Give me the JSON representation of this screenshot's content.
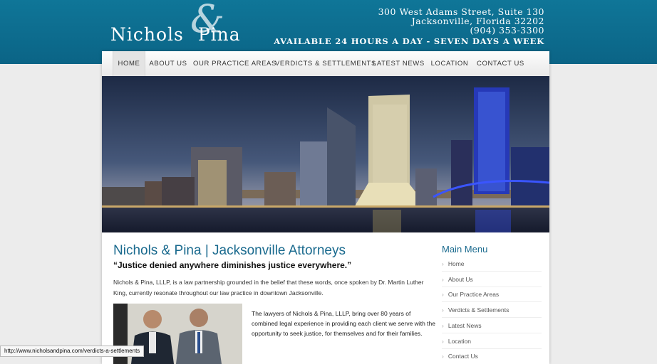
{
  "brand": {
    "name_left": "Nichols",
    "ampersand": "&",
    "name_right": "Pina"
  },
  "contact": {
    "street": "300 West Adams Street, Suite 130",
    "city": "Jacksonville, Florida 32202",
    "phone": "(904) 353-3300",
    "availability": "Available 24 Hours a Day - Seven Days a Week"
  },
  "nav": {
    "items": [
      "HOME",
      "ABOUT US",
      "OUR PRACTICE AREAS",
      "VERDICTS & SETTLEMENTS",
      "LATEST NEWS",
      "LOCATION",
      "CONTACT US"
    ]
  },
  "content": {
    "title": "Nichols & Pina | Jacksonville Attorneys",
    "quote": "“Justice denied anywhere diminishes justice everywhere.”",
    "intro": "Nichols & Pina, LLLP, is a law partnership grounded in the belief that these words, once spoken by Dr. Martin Luther King, currently resonate throughout our law practice in downtown Jacksonville.",
    "body": "The lawyers of Nichols & Pina, LLLP, bring over 80 years of combined legal experience in providing each client we serve with the opportunity to seek justice, for themselves and for their families."
  },
  "sidebar": {
    "title": "Main Menu",
    "items": [
      "Home",
      "About Us",
      "Our Practice Areas",
      "Verdicts & Settlements",
      "Latest News",
      "Location",
      "Contact Us"
    ]
  },
  "status_bar": {
    "url": "http://www.nicholsandpina.com/verdicts-a-settlements"
  },
  "colors": {
    "brand_blue": "#0f7698",
    "heading_blue": "#1a6a8e"
  },
  "icons": {
    "menu_arrow": "chevron-right-icon"
  }
}
